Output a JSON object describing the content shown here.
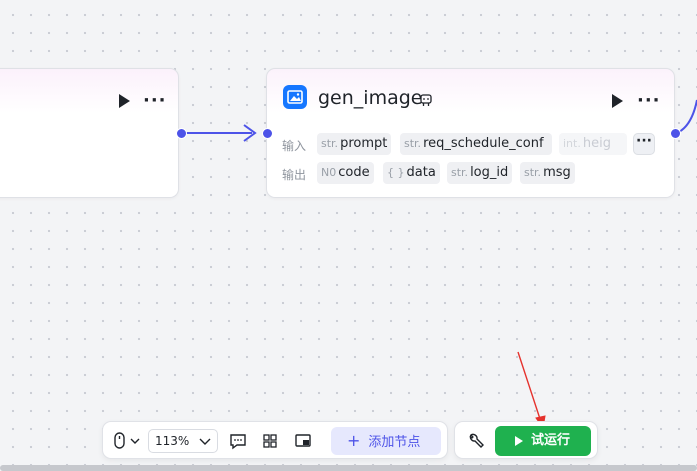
{
  "nodes": {
    "main": {
      "title": "gen_image",
      "input_label": "输入",
      "output_label": "输出",
      "inputs": [
        {
          "type": "str.",
          "name": "prompt"
        },
        {
          "type": "str.",
          "name": "req_schedule_conf"
        },
        {
          "type": "int.",
          "name": "heig"
        }
      ],
      "more_inputs": "···",
      "outputs": [
        {
          "type": "N0",
          "name": "code"
        },
        {
          "type": "{ }",
          "name": "data"
        },
        {
          "type": "str.",
          "name": "log_id"
        },
        {
          "type": "str.",
          "name": "msg"
        }
      ],
      "menu": "···"
    },
    "left": {
      "menu": "···"
    }
  },
  "toolbar": {
    "zoom": "113%",
    "add_node_label": "添加节点",
    "add_icon": "+",
    "run_label": "试运行"
  },
  "colors": {
    "accent": "#4d53e8",
    "run_green": "#1fb14f",
    "annotation_red": "#e5322d",
    "node_icon_blue": "#1677ff"
  }
}
